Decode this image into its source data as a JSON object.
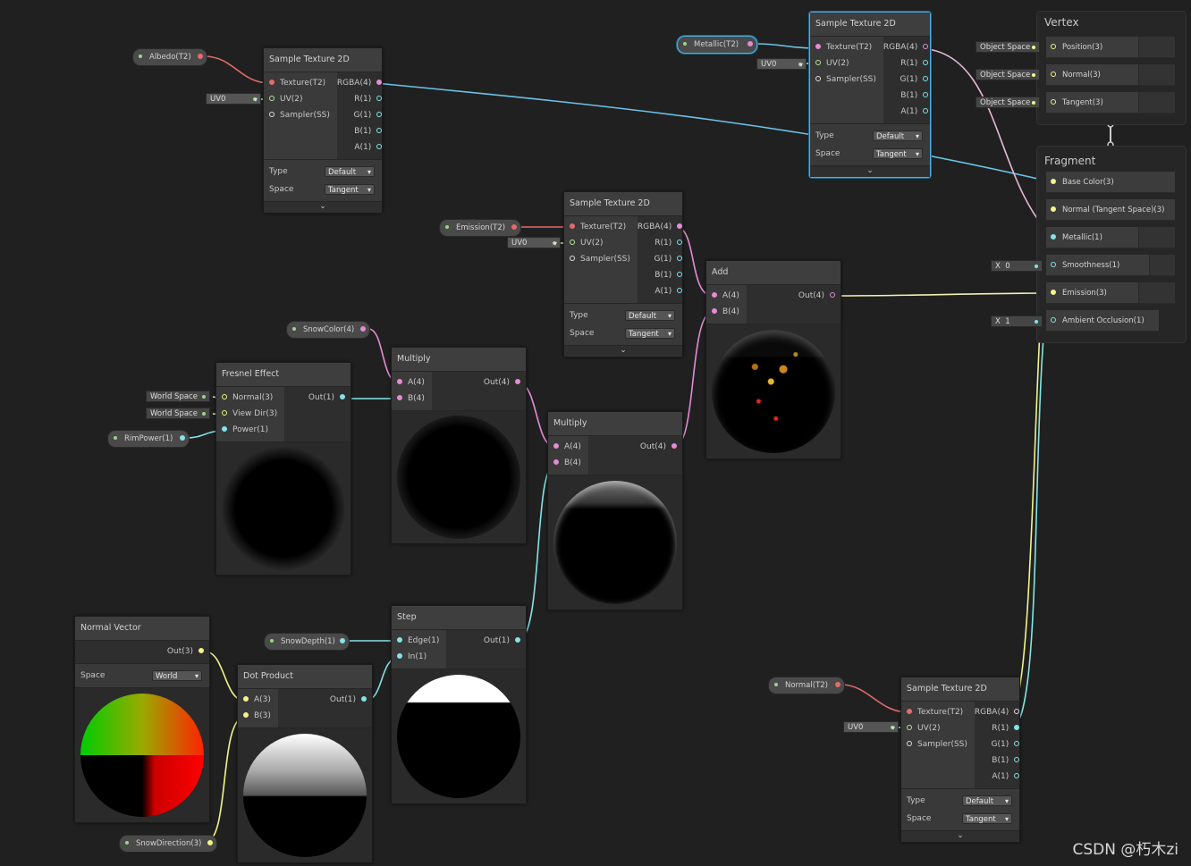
{
  "watermark": "CSDN @朽木zi",
  "colors": {
    "background": "#202020",
    "wire_color": "#e48cd4",
    "wire_vector1": "#84e4e7",
    "wire_vector3": "#f4f48a",
    "wire_texture": "#e46b6b",
    "wire_uv": "#b9e59a",
    "selection": "#4fb0e6"
  },
  "properties": {
    "albedo": "Albedo(T2)",
    "metallic": "Metallic(T2)",
    "emission": "Emission(T2)",
    "snow_color": "SnowColor(4)",
    "rim_power": "RimPower(1)",
    "snow_depth": "SnowDepth(1)",
    "snow_direction": "SnowDirection(3)",
    "normal": "Normal(T2)"
  },
  "common": {
    "uv0": "UV0",
    "world_space": "World Space",
    "object_space": "Object Space",
    "collapse": "⌄"
  },
  "sample_texture": {
    "title": "Sample Texture 2D",
    "in_texture": "Texture(T2)",
    "in_uv": "UV(2)",
    "in_sampler": "Sampler(SS)",
    "out_rgba": "RGBA(4)",
    "out_r": "R(1)",
    "out_g": "G(1)",
    "out_b": "B(1)",
    "out_a": "A(1)",
    "type_label": "Type",
    "type_value": "Default",
    "space_label": "Space",
    "space_value": "Tangent"
  },
  "fresnel": {
    "title": "Fresnel Effect",
    "in_normal": "Normal(3)",
    "in_view": "View Dir(3)",
    "in_power": "Power(1)",
    "out": "Out(1)"
  },
  "multiply1": {
    "title": "Multiply",
    "in_a": "A(4)",
    "in_b": "B(4)",
    "out": "Out(4)"
  },
  "multiply2": {
    "title": "Multiply",
    "in_a": "A(4)",
    "in_b": "B(4)",
    "out": "Out(4)"
  },
  "add": {
    "title": "Add",
    "in_a": "A(4)",
    "in_b": "B(4)",
    "out": "Out(4)"
  },
  "step": {
    "title": "Step",
    "in_edge": "Edge(1)",
    "in_in": "In(1)",
    "out": "Out(1)"
  },
  "normal_vector": {
    "title": "Normal Vector",
    "out": "Out(3)",
    "space_label": "Space",
    "space_value": "World"
  },
  "dot_product": {
    "title": "Dot Product",
    "in_a": "A(3)",
    "in_b": "B(3)",
    "out": "Out(1)"
  },
  "vertex": {
    "title": "Vertex",
    "position": "Position(3)",
    "normal": "Normal(3)",
    "tangent": "Tangent(3)"
  },
  "fragment": {
    "title": "Fragment",
    "base_color": "Base Color(3)",
    "normal_ts": "Normal (Tangent Space)(3)",
    "metallic": "Metallic(1)",
    "smoothness": "Smoothness(1)",
    "emission": "Emission(3)",
    "ao": "Ambient Occlusion(1)",
    "smooth_x": "X",
    "smooth_val": "0",
    "ao_x": "X",
    "ao_val": "1"
  }
}
